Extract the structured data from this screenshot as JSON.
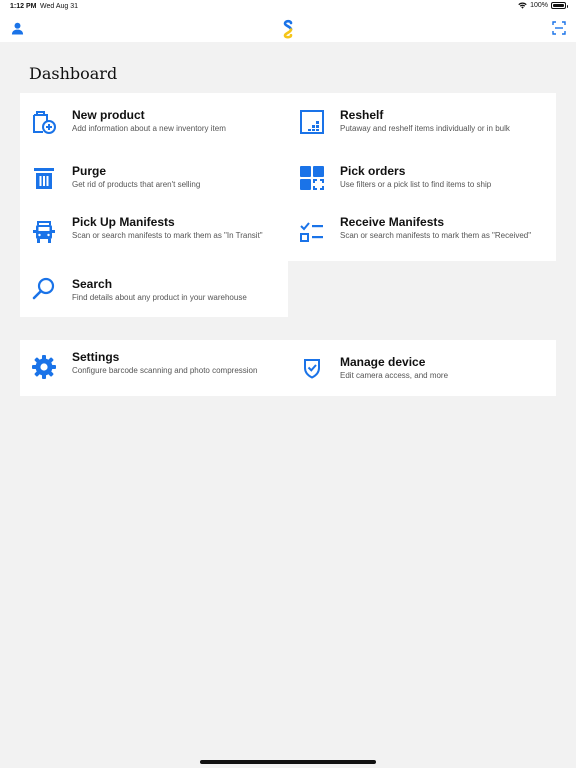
{
  "status_bar": {
    "time": "1:12 PM",
    "date": "Wed Aug 31",
    "battery": "100%",
    "battery_level": 1.0
  },
  "nav": {
    "left_icon": "person-icon",
    "center_icon": "app-logo",
    "right_icon": "scan-icon"
  },
  "page": {
    "title": "Dashboard"
  },
  "tiles": [
    {
      "title": "New product",
      "desc": "Add information about a new inventory item",
      "icon": "new-product-icon"
    },
    {
      "title": "Reshelf",
      "desc": "Putaway and reshelf items individually or in bulk",
      "icon": "reshelf-icon"
    },
    {
      "title": "Purge",
      "desc": "Get rid of products that aren't selling",
      "icon": "trash-icon"
    },
    {
      "title": "Pick orders",
      "desc": "Use filters or a pick list to find items to ship",
      "icon": "pick-orders-icon"
    },
    {
      "title": "Pick Up Manifests",
      "desc": "Scan or search manifests to mark them as \"In Transit\"",
      "icon": "truck-icon"
    },
    {
      "title": "Receive Manifests",
      "desc": "Scan or search manifests to mark them as \"Received\"",
      "icon": "checklist-icon"
    },
    {
      "title": "Search",
      "desc": "Find details about any product in your warehouse",
      "icon": "search-icon"
    }
  ],
  "settings": [
    {
      "title": "Settings",
      "desc": "Configure barcode scanning and photo compression",
      "icon": "gear-icon"
    },
    {
      "title": "Manage device",
      "desc": "Edit camera access, and more",
      "icon": "shield-icon"
    }
  ],
  "colors": {
    "accent": "#1a73e8",
    "background": "#f2f2f2",
    "card": "#ffffff"
  }
}
